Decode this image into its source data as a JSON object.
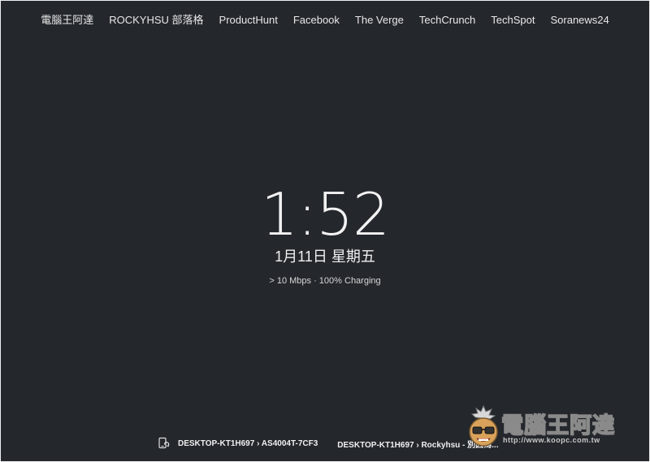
{
  "nav": {
    "items": [
      {
        "label": "電腦王阿達"
      },
      {
        "label": "ROCKYHSU 部落格"
      },
      {
        "label": "ProductHunt"
      },
      {
        "label": "Facebook"
      },
      {
        "label": "The Verge"
      },
      {
        "label": "TechCrunch"
      },
      {
        "label": "TechSpot"
      },
      {
        "label": "Soranews24"
      }
    ]
  },
  "clock": {
    "time": "1:52",
    "date": "1月11日 星期五",
    "status": "> 10 Mbps · 100% Charging"
  },
  "bottom_bar": {
    "icon": "device-sync-icon",
    "tabs": [
      {
        "label": "DESKTOP-KT1H697 › AS4004T-7CF3"
      },
      {
        "label": "DESKTOP-KT1H697 › Rockyhsu - 別因為..."
      }
    ]
  },
  "watermark": {
    "logo_text": "電腦王阿達",
    "url": "http://www.koopc.com.tw"
  }
}
